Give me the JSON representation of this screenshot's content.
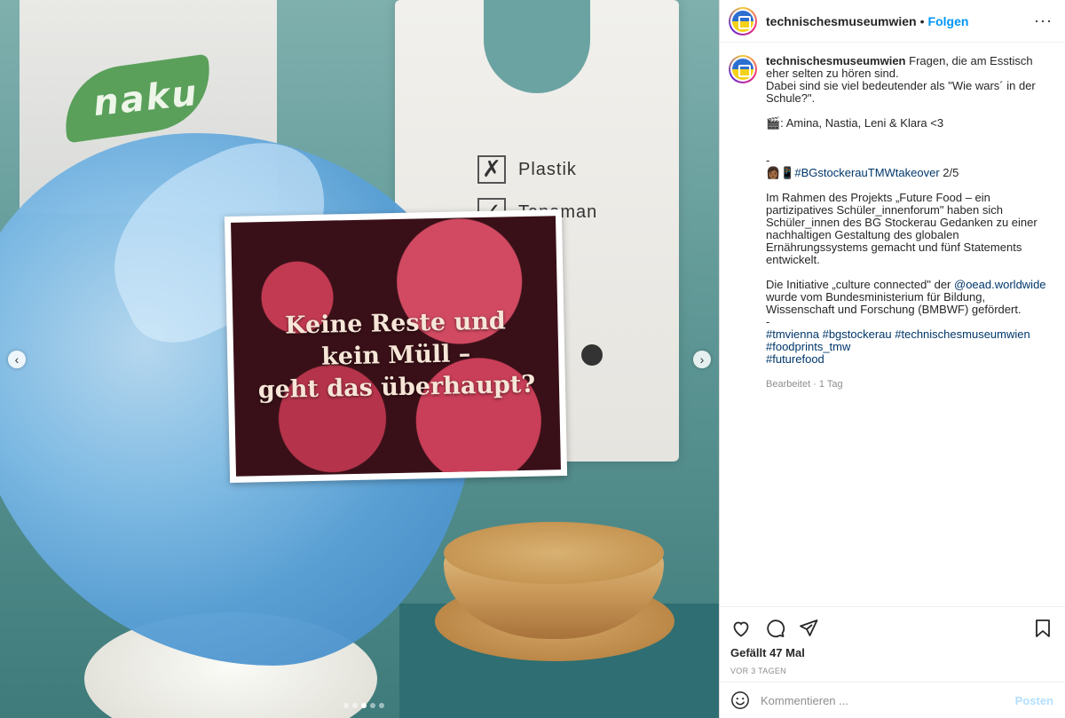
{
  "media": {
    "leaf_text": "naku",
    "checklist": [
      {
        "mark": "✗",
        "label": "Plastik"
      },
      {
        "mark": "✓",
        "label": "Tanaman"
      }
    ],
    "card_lines": [
      "Keine Reste und",
      "kein Müll –",
      "geht das überhaupt?"
    ],
    "prev_icon": "chevron-left-icon",
    "next_icon": "chevron-right-icon",
    "slides_total": 5,
    "slide_active": 3
  },
  "header": {
    "username": "technischesmuseumwien",
    "separator": "•",
    "follow_label": "Folgen",
    "more_icon": "more-horizontal-icon",
    "more_label": "···"
  },
  "caption": {
    "username": "technischesmuseumwien",
    "line1": "Fragen, die am Esstisch eher selten zu hören sind.",
    "line2": "Dabei sind sie viel bedeutender als \"Wie wars´ in der Schule?\".",
    "credits": "🎬: Amina, Nastia, Leni & Klara <3",
    "dash1": "-",
    "takeover_prefix": "👩🏾📱",
    "takeover_tag": "#BGstockerauTMWtakeover",
    "takeover_suffix": " 2/5",
    "para1": "Im Rahmen des Projekts „Future Food – ein partizipatives Schüler_innenforum\" haben sich Schüler_innen des BG Stockerau Gedanken zu einer nachhaltigen Gestaltung des globalen Ernährungssystems gemacht und fünf Statements entwickelt.",
    "para2_a": "Die Initiative „culture connected\" der ",
    "para2_mention": "@oead.worldwide",
    "para2_b": " wurde vom Bundesministerium für Bildung, Wissenschaft und Forschung (BMBWF) gefördert.",
    "dash2": "-",
    "hashtags_1": "#tmvienna #bgstockerau #technischesmuseumwien",
    "hashtags_2": "#foodprints_tmw",
    "hashtags_3": "#futurefood",
    "edited": "Bearbeitet · 1 Tag"
  },
  "actions": {
    "icons": [
      "heart-icon",
      "comment-icon",
      "share-icon",
      "bookmark-icon"
    ],
    "likes": "Gefällt 47 Mal",
    "time": "VOR 3 TAGEN"
  },
  "comment_box": {
    "placeholder": "Kommentieren ...",
    "post_label": "Posten",
    "emoji_icon": "emoji-icon"
  }
}
